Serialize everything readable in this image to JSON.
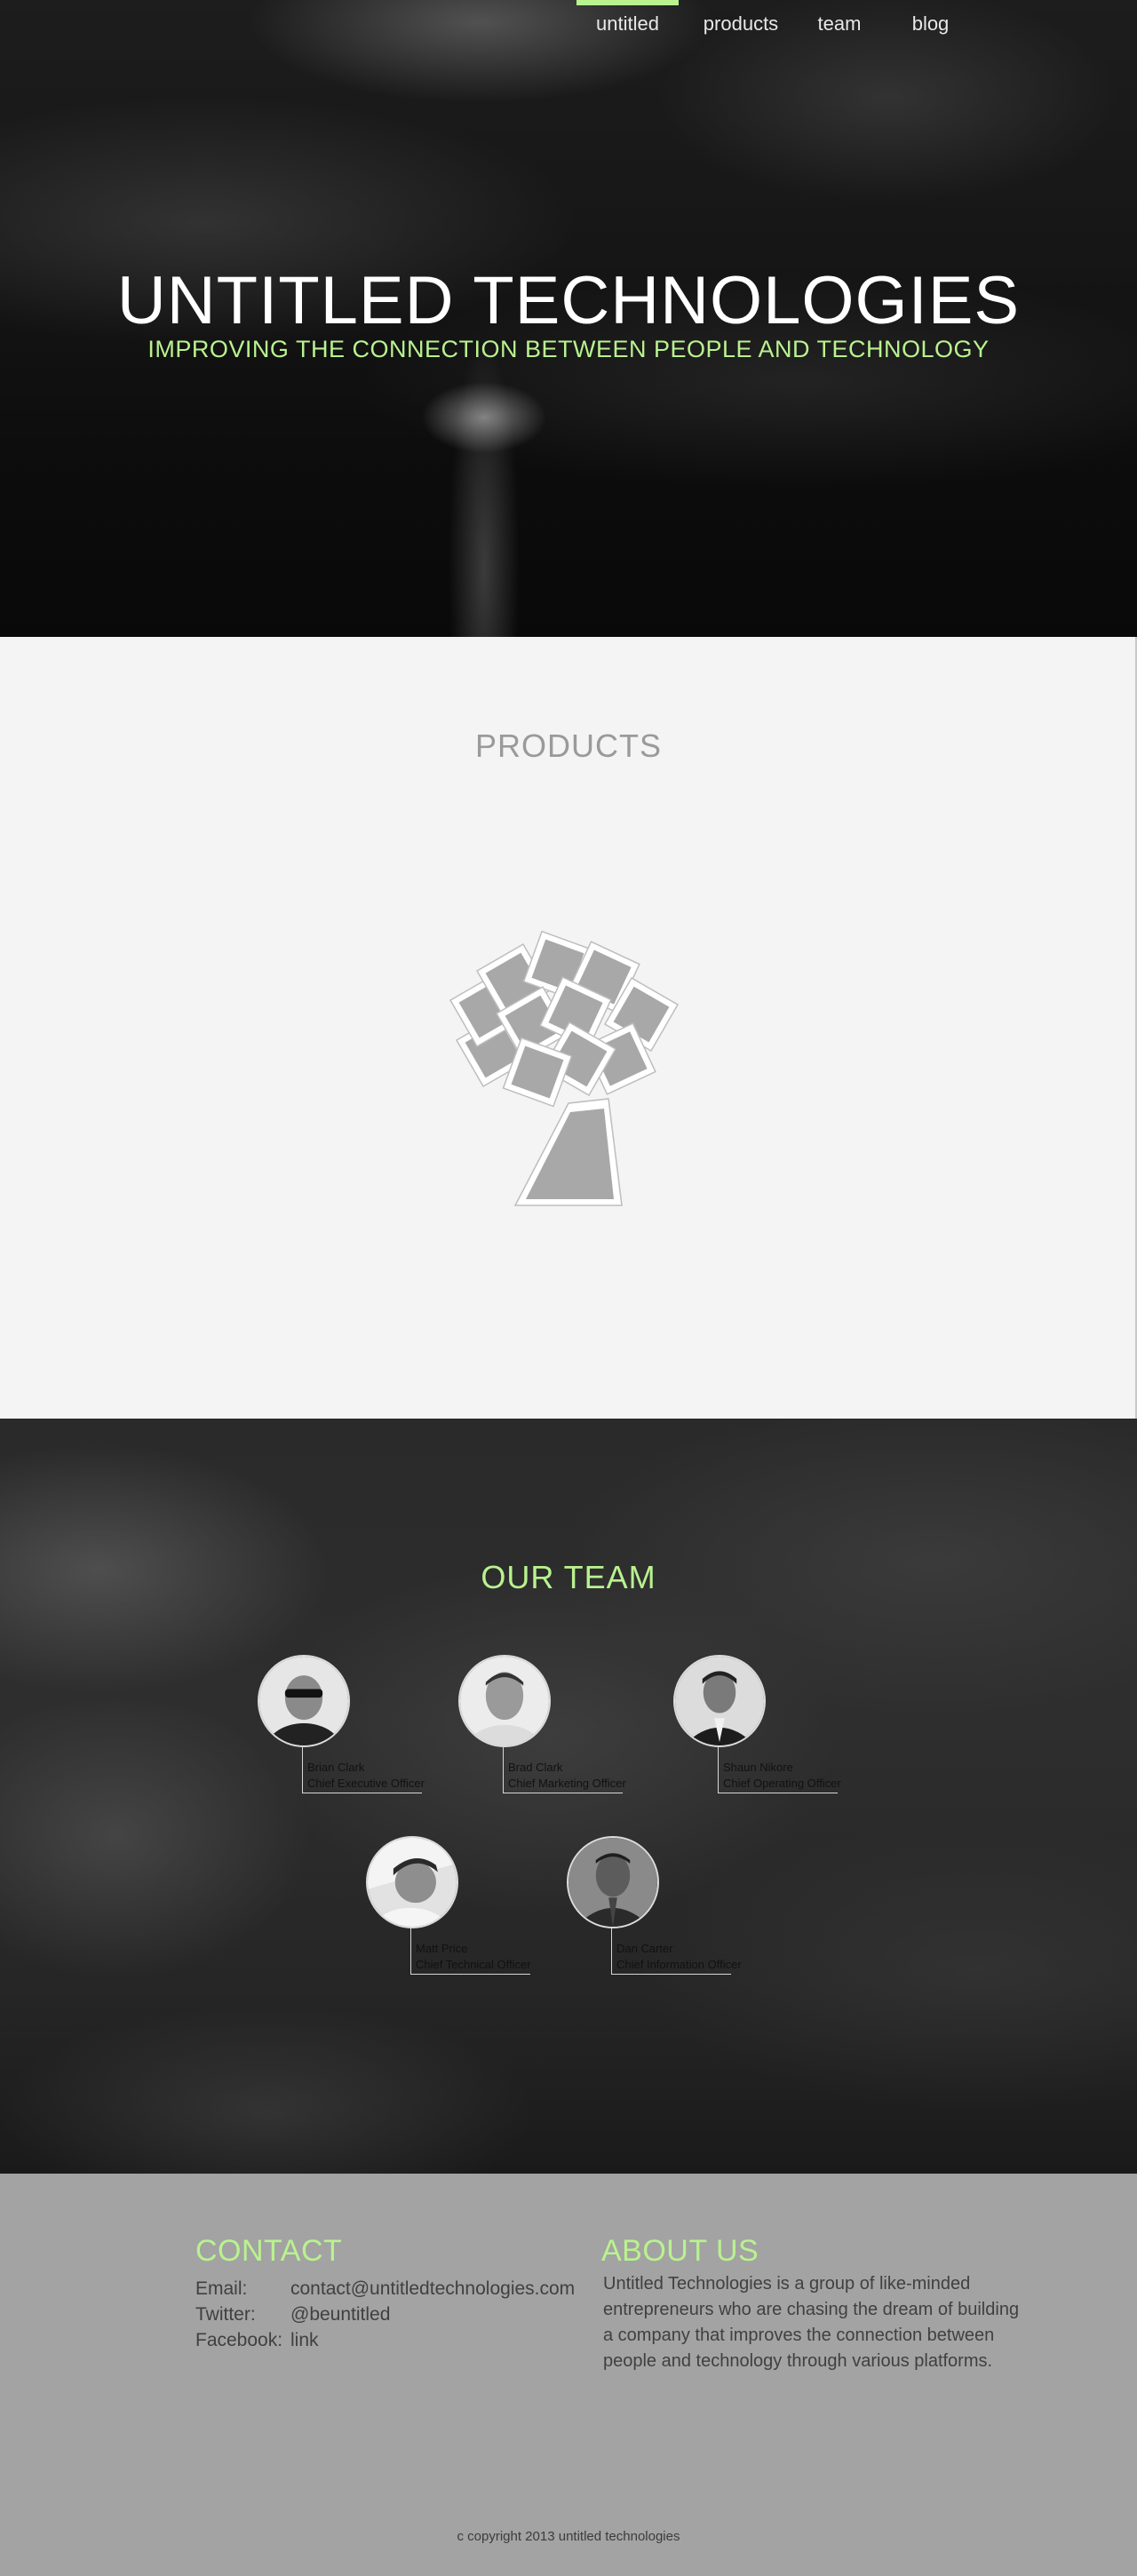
{
  "nav": {
    "items": [
      {
        "label": "untitled",
        "active": true
      },
      {
        "label": "products",
        "active": false
      },
      {
        "label": "team",
        "active": false
      },
      {
        "label": "blog",
        "active": false
      }
    ]
  },
  "hero": {
    "title": "UNTITLED TECHNOLOGIES",
    "tagline": "IMPROVING THE CONNECTION BETWEEN PEOPLE AND TECHNOLOGY"
  },
  "products": {
    "heading": "PRODUCTS",
    "logo_icon": "tree-logo-icon"
  },
  "team": {
    "heading": "OUR TEAM",
    "members": [
      {
        "name": "Brian Clark",
        "role": "Chief Executive Officer"
      },
      {
        "name": "Brad Clark",
        "role": "Chief Marketing Officer"
      },
      {
        "name": "Shaun Nikore",
        "role": "Chief Operating Officer"
      },
      {
        "name": "Matt Price",
        "role": "Chief Technical Officer"
      },
      {
        "name": "Dan Carter",
        "role": "Chief Information Officer"
      }
    ]
  },
  "contact": {
    "heading": "CONTACT",
    "rows": [
      {
        "label": "Email:",
        "value": "contact@untitledtechnologies.com"
      },
      {
        "label": "Twitter:",
        "value": "@beuntitled"
      },
      {
        "label": "Facebook:",
        "value": "link"
      }
    ]
  },
  "about": {
    "heading": "ABOUT US",
    "text": "Untitled Technologies is a group of like-minded entrepreneurs who are chasing the dream of building a company that improves the connection between people and technology through various platforms."
  },
  "footer": {
    "copyright": "c copyright 2013 untitled technologies"
  },
  "colors": {
    "accent": "#b9f28f",
    "products_bg": "#f4f4f4",
    "footer_bg": "#a3a3a3",
    "logo_gray": "#a8a8a8"
  }
}
